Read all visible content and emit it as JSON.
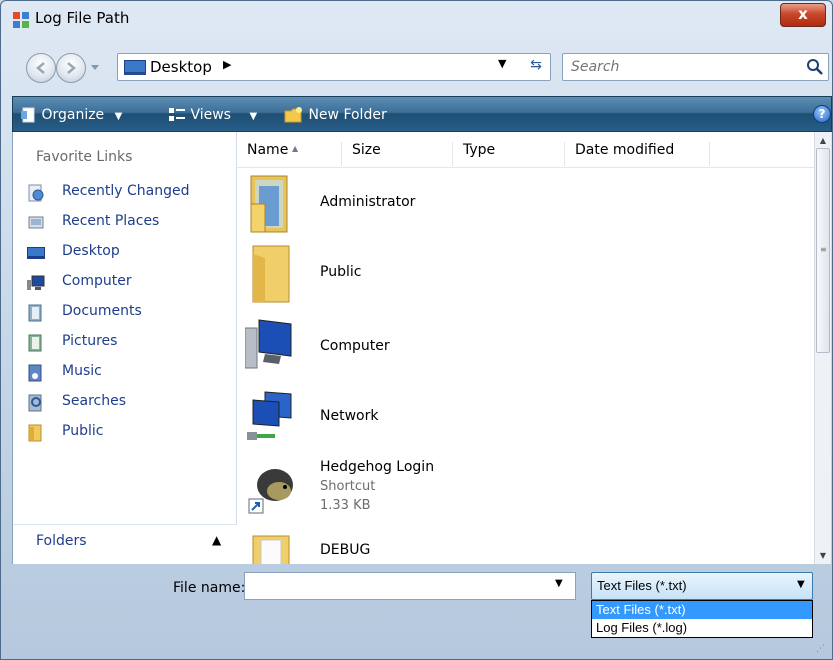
{
  "window": {
    "title": "Log File Path",
    "close_label": "x"
  },
  "address_bar": {
    "location": "Desktop"
  },
  "search": {
    "placeholder": "Search"
  },
  "toolbar": {
    "organize_label": "Organize",
    "views_label": "Views",
    "new_folder_label": "New Folder"
  },
  "nav_pane": {
    "heading": "Favorite Links",
    "items": [
      {
        "label": "Recently Changed",
        "icon": "recently-changed-icon"
      },
      {
        "label": "Recent Places",
        "icon": "recent-places-icon"
      },
      {
        "label": "Desktop",
        "icon": "desktop-icon"
      },
      {
        "label": "Computer",
        "icon": "computer-icon"
      },
      {
        "label": "Documents",
        "icon": "documents-icon"
      },
      {
        "label": "Pictures",
        "icon": "pictures-icon"
      },
      {
        "label": "Music",
        "icon": "music-icon"
      },
      {
        "label": "Searches",
        "icon": "searches-icon"
      },
      {
        "label": "Public",
        "icon": "folder-icon"
      }
    ],
    "folders_label": "Folders"
  },
  "file_list": {
    "columns": [
      "Name",
      "Size",
      "Type",
      "Date modified"
    ],
    "items": [
      {
        "name": "Administrator",
        "icon": "user-folder-icon"
      },
      {
        "name": "Public",
        "icon": "folder-icon"
      },
      {
        "name": "Computer",
        "icon": "computer-icon"
      },
      {
        "name": "Network",
        "icon": "network-icon"
      },
      {
        "name": "Hedgehog Login",
        "type": "Shortcut",
        "size": "1.33 KB",
        "icon": "hedgehog-shortcut-icon"
      },
      {
        "name": "DEBUG",
        "icon": "folder-icon"
      }
    ]
  },
  "footer": {
    "filename_label": "File name:",
    "filename_value": "",
    "filetype_selected": "Text Files (*.txt)",
    "filetype_options": [
      "Text Files (*.txt)",
      "Log Files (*.log)"
    ]
  },
  "colors": {
    "toolbar": "#275d87",
    "link": "#1e3e8c",
    "selection": "#3399ff",
    "close": "#c9472b"
  }
}
